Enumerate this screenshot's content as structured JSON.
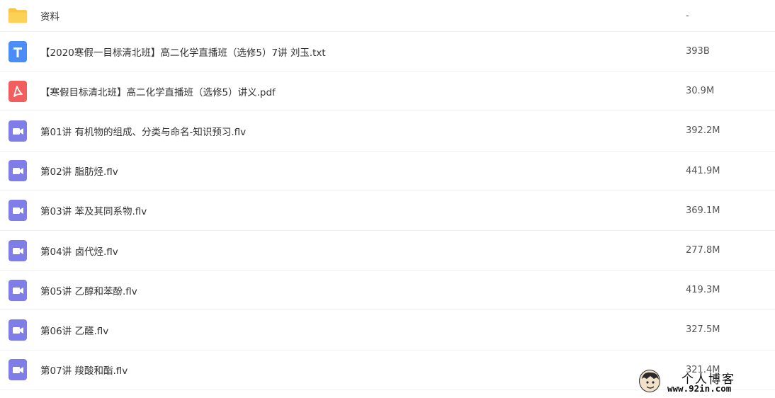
{
  "colors": {
    "folder": "#f9c542",
    "txt": "#4a8df8",
    "pdf": "#f25d5d",
    "video": "#7f7ee8",
    "divider": "#f1f2f4"
  },
  "files": [
    {
      "name": "资料",
      "size": "-",
      "icon": "folder-icon"
    },
    {
      "name": "【2020寒假一目标清北班】高二化学直播班（选修5）7讲 刘玉.txt",
      "size": "393B",
      "icon": "txt-file-icon"
    },
    {
      "name": "【寒假目标清北班】高二化学直播班（选修5）讲义.pdf",
      "size": "30.9M",
      "icon": "pdf-file-icon"
    },
    {
      "name": "第01讲 有机物的组成、分类与命名-知识预习.flv",
      "size": "392.2M",
      "icon": "video-file-icon"
    },
    {
      "name": "第02讲 脂肪烃.flv",
      "size": "441.9M",
      "icon": "video-file-icon"
    },
    {
      "name": "第03讲 苯及其同系物.flv",
      "size": "369.1M",
      "icon": "video-file-icon"
    },
    {
      "name": "第04讲 卤代烃.flv",
      "size": "277.8M",
      "icon": "video-file-icon"
    },
    {
      "name": "第05讲 乙醇和苯酚.flv",
      "size": "419.3M",
      "icon": "video-file-icon"
    },
    {
      "name": "第06讲 乙醛.flv",
      "size": "327.5M",
      "icon": "video-file-icon"
    },
    {
      "name": "第07讲 羧酸和酯.flv",
      "size": "321.4M",
      "icon": "video-file-icon"
    }
  ],
  "watermark": {
    "title": "个人博客",
    "url": "www.92in.com"
  }
}
